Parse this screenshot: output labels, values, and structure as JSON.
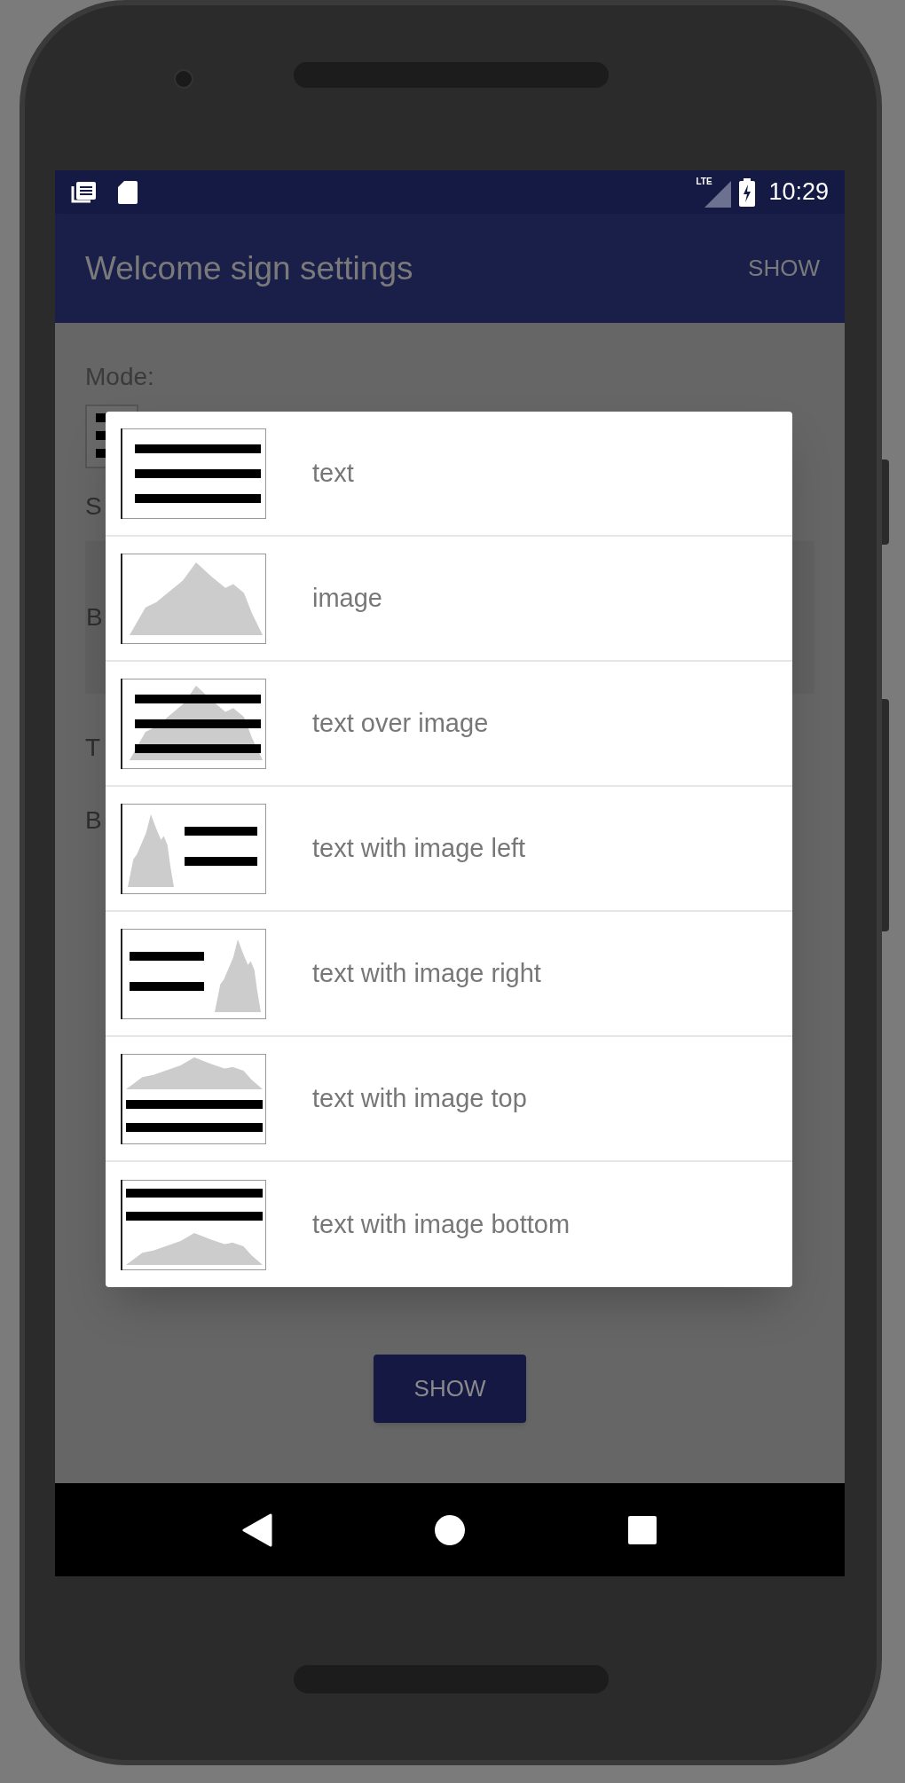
{
  "status_bar": {
    "time": "10:29",
    "signal_label": "LTE"
  },
  "app_bar": {
    "title": "Welcome sign settings",
    "action": "SHOW"
  },
  "form": {
    "mode_label": "Mode:",
    "partial_labels": [
      "S",
      "B",
      "T",
      "B"
    ]
  },
  "dialog": {
    "items": [
      {
        "label": "text",
        "kind": "text"
      },
      {
        "label": "image",
        "kind": "image"
      },
      {
        "label": "text over image",
        "kind": "text_over_image"
      },
      {
        "label": "text with image left",
        "kind": "image_left"
      },
      {
        "label": "text with image right",
        "kind": "image_right"
      },
      {
        "label": "text with image top",
        "kind": "image_top"
      },
      {
        "label": "text with image bottom",
        "kind": "image_bottom"
      }
    ]
  },
  "button": "SHOW"
}
